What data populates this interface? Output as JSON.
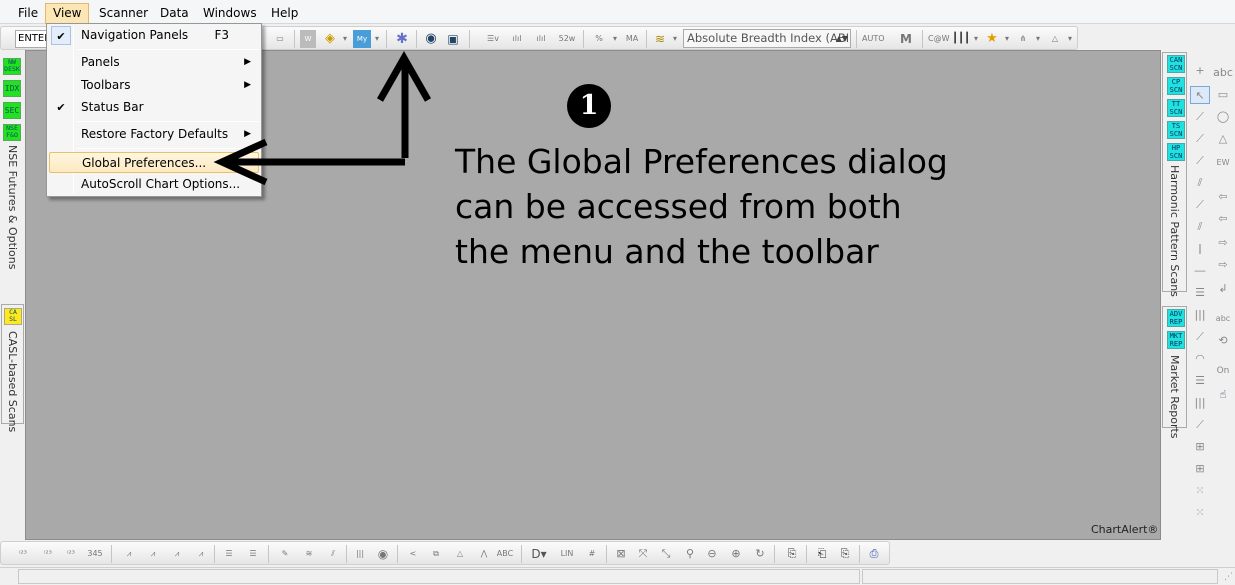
{
  "menubar": {
    "items": [
      "File",
      "View",
      "Scanner",
      "Data",
      "Windows",
      "Help"
    ]
  },
  "toolbar_top": {
    "enter_combo_value": "ENTER",
    "breadth_combo_value": "Absolute Breadth Index (ABI"
  },
  "view_menu": {
    "navigation_panels": "Navigation Panels",
    "navigation_panels_shortcut": "F3",
    "panels": "Panels",
    "toolbars": "Toolbars",
    "status_bar": "Status Bar",
    "restore_factory_defaults": "Restore Factory Defaults",
    "global_preferences": "Global Preferences...",
    "autoscroll_chart_options": "AutoScroll Chart Options..."
  },
  "left_panel": {
    "buttons": [
      "NW\nDESK",
      "IDX",
      "SEC",
      "NSE\nF&O"
    ],
    "nse_panel_label": "NSE Futures & Options",
    "casl_button": "CA\nSL",
    "casl_panel_label": "CASL-based Scans"
  },
  "right_panel": {
    "scan_buttons": [
      "CAN\nSCN",
      "CP\nSCN",
      "TT\nSCN",
      "TS\nSCN",
      "HP\nSCN"
    ],
    "harmonic_label": "Harmonic Pattern Scans",
    "report_buttons": [
      "ADV\nREP",
      "MKT\nREP"
    ],
    "market_reports_label": "Market Reports"
  },
  "annotation": {
    "badge": "1",
    "line1": "The Global Preferences dialog",
    "line2": "can be accessed from both",
    "line3": "the menu and the toolbar"
  },
  "watermark": "ChartAlert®",
  "colors": {
    "chart_area": "#a9a9a9",
    "nav_button_green": "#22e022",
    "scan_button_cyan": "#20e0e0",
    "casl_button_yellow": "#ffe820",
    "menu_highlight": "#fde6b6"
  }
}
